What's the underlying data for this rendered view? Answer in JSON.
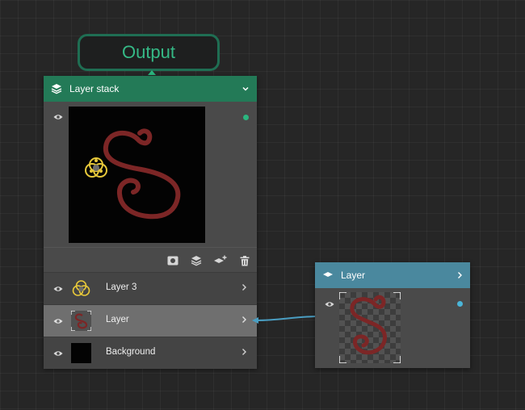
{
  "output_badge": {
    "label": "Output"
  },
  "layer_stack_node": {
    "title": "Layer stack",
    "layers": [
      {
        "label": "Layer 3",
        "selected": false
      },
      {
        "label": "Layer",
        "selected": true
      },
      {
        "label": "Background",
        "selected": false
      }
    ],
    "toolbar_icons": [
      "mask-icon",
      "layers-icon",
      "add-layer-icon",
      "trash-icon"
    ]
  },
  "layer_node": {
    "title": "Layer"
  },
  "colors": {
    "canvas": "#262626",
    "output_text": "#35b986",
    "stack_header": "#237a57",
    "layer_header": "#4a889e",
    "node_body": "#4a4a4a",
    "selected_row": "#6f6f6f",
    "swirl": "#7c2626",
    "ring": "#e8c93a",
    "wire": "#4a9ec2"
  }
}
